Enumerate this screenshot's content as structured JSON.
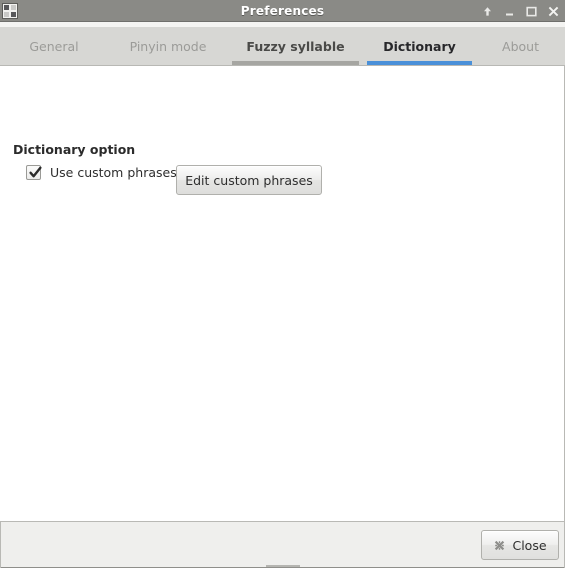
{
  "window": {
    "title": "Preferences",
    "app_icon": "app-squares-icon",
    "controls": [
      {
        "name": "shade-window-button",
        "icon": "up-arrow-icon",
        "label": ""
      },
      {
        "name": "minimize-window-button",
        "icon": "minimize-icon",
        "label": ""
      },
      {
        "name": "maximize-window-button",
        "icon": "maximize-icon",
        "label": ""
      },
      {
        "name": "close-window-button",
        "icon": "close-x-icon",
        "label": ""
      }
    ]
  },
  "tabs": [
    {
      "label": "General",
      "state": "normal"
    },
    {
      "label": "Pinyin mode",
      "state": "normal"
    },
    {
      "label": "Fuzzy syllable",
      "state": "hovered"
    },
    {
      "label": "Dictionary",
      "state": "active"
    },
    {
      "label": "About",
      "state": "normal"
    }
  ],
  "main": {
    "section_title": "Dictionary option",
    "checkbox": {
      "label": "Use custom phrases",
      "checked": true
    },
    "edit_button": {
      "label": "Edit custom phrases"
    }
  },
  "actionbar": {
    "close_button": {
      "label": "Close",
      "icon": "close-cross-icon"
    }
  },
  "colors": {
    "titlebar": "#8a8a86",
    "tabstrip": "#d7d7d4",
    "active_tab_underline": "#4a90d9",
    "hovered_tab_underline": "#a6a6a2",
    "content": "#ffffff",
    "actionbar": "#efefed"
  }
}
